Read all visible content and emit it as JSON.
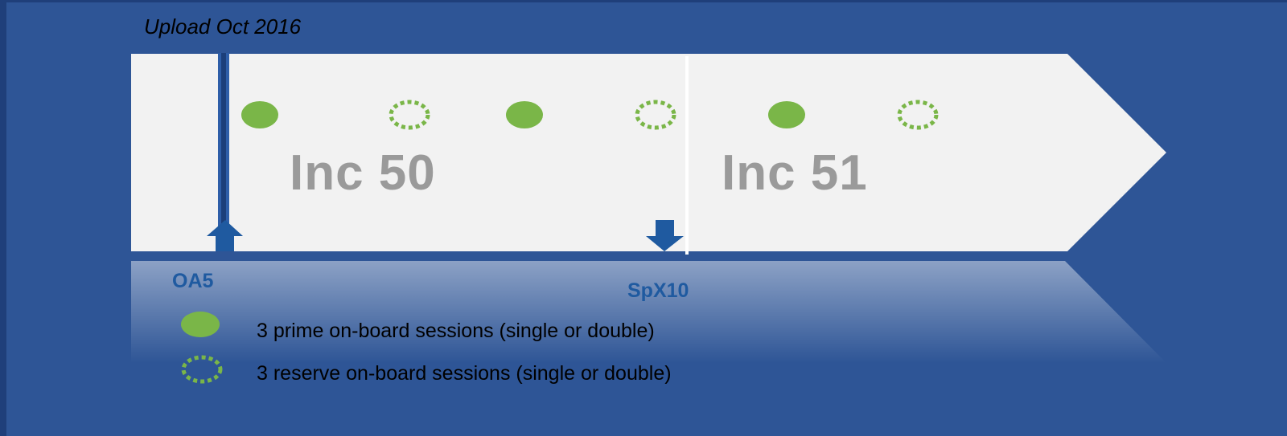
{
  "upload_label": "Upload Oct 2016",
  "increments": [
    {
      "label": "Inc 50"
    },
    {
      "label": "Inc 51"
    }
  ],
  "markers": {
    "up": {
      "label": "OA5"
    },
    "down": {
      "label": "SpX10"
    }
  },
  "sessions_sequence": [
    "prime",
    "reserve",
    "prime",
    "reserve",
    "prime",
    "reserve"
  ],
  "legend": {
    "prime": "3 prime on-board sessions (single or double)",
    "reserve": "3 reserve on-board sessions (single or double)"
  },
  "colors": {
    "background": "#2e5596",
    "prime_fill": "#7ab648",
    "reserve_stroke": "#7ab648",
    "arrow": "#1f5aa0",
    "timeline": "#f2f2f2",
    "inc_text": "#9a9a9a"
  }
}
